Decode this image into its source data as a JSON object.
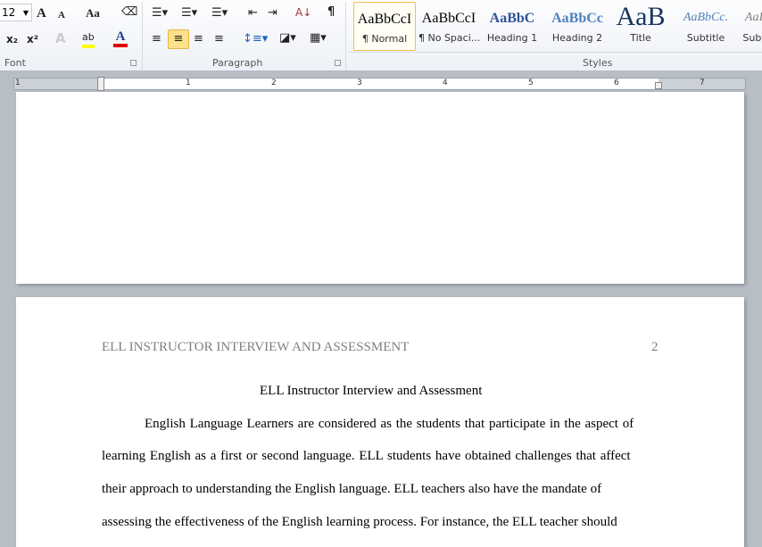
{
  "font": {
    "size": "12",
    "group_label": "Font",
    "grow_icon": "A",
    "shrink_icon": "A",
    "case_label": "Aa",
    "subscript": "x₂",
    "superscript": "x²",
    "text_effect": "A",
    "highlight": "ab",
    "font_color": "A",
    "highlight_color": "#ffff00",
    "font_color_value": "#e00000"
  },
  "paragraph": {
    "group_label": "Paragraph",
    "show_marks": "¶"
  },
  "styles": {
    "group_label": "Styles",
    "items": [
      {
        "preview": "AaBbCcI",
        "label": "¶ Normal",
        "selected": true,
        "color": "#000000"
      },
      {
        "preview": "AaBbCcI",
        "label": "¶ No Spaci...",
        "color": "#000000"
      },
      {
        "preview": "AaBbC",
        "label": "Heading 1",
        "color": "#2f5496"
      },
      {
        "preview": "AaBbCc",
        "label": "Heading 2",
        "color": "#4f81bd"
      },
      {
        "preview": "AaB",
        "label": "Title",
        "color": "#17365d"
      },
      {
        "preview": "AaBbCc.",
        "label": "Subtitle",
        "color": "#4f81bd"
      },
      {
        "preview": "AaI",
        "label": "Subt",
        "color": "#7f7f7f"
      }
    ]
  },
  "ruler": {
    "numbers": [
      "1",
      "1",
      "2",
      "3",
      "4",
      "5",
      "6",
      "7"
    ]
  },
  "document": {
    "header": "ELL INSTRUCTOR INTERVIEW AND ASSESSMENT",
    "page_number": "2",
    "title": "ELL Instructor Interview and Assessment",
    "lines": [
      "English Language Learners are considered as the students that participate in the aspect of",
      "learning English as a first or second language. ELL students have obtained challenges that affect",
      "their approach to understanding the English language. ELL teachers also have the mandate of",
      "assessing  the effectiveness of the English learning process. For instance, the ELL teacher should"
    ]
  }
}
